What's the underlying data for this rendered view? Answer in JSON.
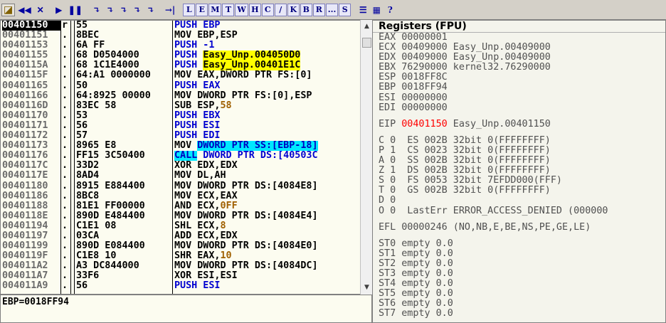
{
  "toolbar": {
    "items": [
      "◪",
      "◀◀",
      "✕",
      "▶",
      "❚❚",
      "↴",
      "↴",
      "↴",
      "↴",
      "↴",
      "→|",
      "L",
      "E",
      "M",
      "T",
      "W",
      "H",
      "C",
      "/",
      "K",
      "B",
      "R",
      "...",
      "S",
      "☰",
      "▦",
      "?"
    ]
  },
  "disasm": {
    "rows": [
      {
        "addr": "00401150",
        "bar": "r",
        "hex": "55",
        "asm": "PUSH EBP"
      },
      {
        "addr": "00401151",
        "bar": ".",
        "hex": "8BEC",
        "asm": "MOV EBP,ESP"
      },
      {
        "addr": "00401153",
        "bar": ".",
        "hex": "6A FF",
        "asm": "PUSH -1"
      },
      {
        "addr": "00401155",
        "bar": ".",
        "hex": "68 D0504000",
        "asm_a": "PUSH ",
        "asm_b": "Easy_Unp.004050D0"
      },
      {
        "addr": "0040115A",
        "bar": ".",
        "hex": "68 1C1E4000",
        "asm_a": "PUSH ",
        "asm_b": "Easy_Unp.00401E1C"
      },
      {
        "addr": "0040115F",
        "bar": ".",
        "hex": "64:A1 0000000",
        "asm": "MOV EAX,DWORD PTR FS:[0]"
      },
      {
        "addr": "00401165",
        "bar": ".",
        "hex": "50",
        "asm": "PUSH EAX"
      },
      {
        "addr": "00401166",
        "bar": ".",
        "hex": "64:8925 00000",
        "asm": "MOV DWORD PTR FS:[0],ESP"
      },
      {
        "addr": "0040116D",
        "bar": ".",
        "hex": "83EC 58",
        "asm_a": "SUB ESP,",
        "asm_b": "58"
      },
      {
        "addr": "00401170",
        "bar": ".",
        "hex": "53",
        "asm": "PUSH EBX"
      },
      {
        "addr": "00401171",
        "bar": ".",
        "hex": "56",
        "asm": "PUSH ESI"
      },
      {
        "addr": "00401172",
        "bar": ".",
        "hex": "57",
        "asm": "PUSH EDI"
      },
      {
        "addr": "00401173",
        "bar": ".",
        "hex": "8965 E8",
        "asm_a": "MOV ",
        "asm_b": "DWORD PTR SS:[EBP-18]"
      },
      {
        "addr": "00401176",
        "bar": ".",
        "hex": "FF15 3C50400",
        "asm_a": "CALL",
        "asm_b": " DWORD PTR DS:[40503C"
      },
      {
        "addr": "0040117C",
        "bar": ".",
        "hex": "33D2",
        "asm": "XOR EDX,EDX"
      },
      {
        "addr": "0040117E",
        "bar": ".",
        "hex": "8AD4",
        "asm": "MOV DL,AH"
      },
      {
        "addr": "00401180",
        "bar": ".",
        "hex": "8915 E884400",
        "asm": "MOV DWORD PTR DS:[4084E8]"
      },
      {
        "addr": "00401186",
        "bar": ".",
        "hex": "8BC8",
        "asm": "MOV ECX,EAX"
      },
      {
        "addr": "00401188",
        "bar": ".",
        "hex": "81E1 FF00000",
        "asm_a": "AND ECX,",
        "asm_b": "0FF"
      },
      {
        "addr": "0040118E",
        "bar": ".",
        "hex": "890D E484400",
        "asm": "MOV DWORD PTR DS:[4084E4]"
      },
      {
        "addr": "00401194",
        "bar": ".",
        "hex": "C1E1 08",
        "asm_a": "SHL ECX,",
        "asm_b": "8"
      },
      {
        "addr": "00401197",
        "bar": ".",
        "hex": "03CA",
        "asm": "ADD ECX,EDX"
      },
      {
        "addr": "00401199",
        "bar": ".",
        "hex": "890D E084400",
        "asm": "MOV DWORD PTR DS:[4084E0]"
      },
      {
        "addr": "0040119F",
        "bar": ".",
        "hex": "C1E8 10",
        "asm_a": "SHR EAX,",
        "asm_b": "10"
      },
      {
        "addr": "004011A2",
        "bar": ".",
        "hex": "A3 DC844000",
        "asm": "MOV DWORD PTR DS:[4084DC]"
      },
      {
        "addr": "004011A7",
        "bar": ".",
        "hex": "33F6",
        "asm": "XOR ESI,ESI"
      },
      {
        "addr": "004011A9",
        "bar": ".",
        "hex": "56",
        "asm": "PUSH ESI"
      }
    ]
  },
  "info": {
    "text": "EBP=0018FF94"
  },
  "registers": {
    "title": "Registers (FPU)",
    "gpr": [
      "EAX 00000001",
      "ECX 00409000 Easy_Unp.00409000",
      "EDX 00409000 Easy_Unp.00409000",
      "EBX 76290000 kernel32.76290000",
      "ESP 0018FF8C",
      "EBP 0018FF94",
      "ESI 00000000",
      "EDI 00000000"
    ],
    "eip_label": "EIP ",
    "eip_value": "00401150",
    "eip_comment": " Easy_Unp.00401150",
    "flags": [
      "C 0  ES 002B 32bit 0(FFFFFFFF)",
      "P 1  CS 0023 32bit 0(FFFFFFFF)",
      "A 0  SS 002B 32bit 0(FFFFFFFF)",
      "Z 1  DS 002B 32bit 0(FFFFFFFF)",
      "S 0  FS 0053 32bit 7EFDD000(FFF)",
      "T 0  GS 002B 32bit 0(FFFFFFFF)",
      "D 0",
      "O 0  LastErr ERROR_ACCESS_DENIED (000000"
    ],
    "efl": "EFL 00000246 (NO,NB,E,BE,NS,PE,GE,LE)",
    "fpu": [
      "ST0 empty 0.0",
      "ST1 empty 0.0",
      "ST2 empty 0.0",
      "ST3 empty 0.0",
      "ST4 empty 0.0",
      "ST5 empty 0.0",
      "ST6 empty 0.0",
      "ST7 empty 0.0"
    ]
  }
}
